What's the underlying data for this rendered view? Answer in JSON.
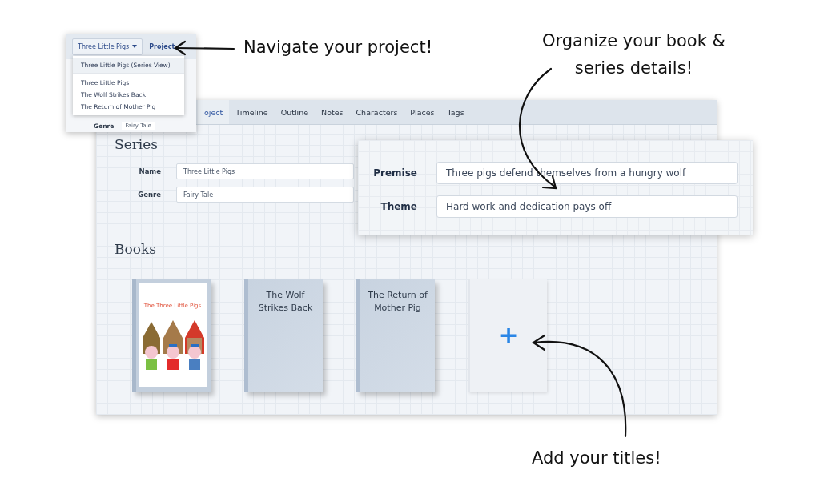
{
  "window": {
    "tabs": [
      {
        "label": "oject",
        "selected": true
      },
      {
        "label": "Timeline",
        "selected": false
      },
      {
        "label": "Outline",
        "selected": false
      },
      {
        "label": "Notes",
        "selected": false
      },
      {
        "label": "Characters",
        "selected": false
      },
      {
        "label": "Places",
        "selected": false
      },
      {
        "label": "Tags",
        "selected": false
      }
    ],
    "series": {
      "heading": "Series",
      "fields": [
        {
          "label": "Name",
          "value": "Three Little Pigs"
        },
        {
          "label": "Genre",
          "value": "Fairy Tale"
        }
      ]
    },
    "books": {
      "heading": "Books",
      "items": [
        {
          "kind": "cover",
          "title": "The Three Little Pigs"
        },
        {
          "kind": "plain",
          "title": "The Wolf Strikes Back"
        },
        {
          "kind": "plain",
          "title": "The Return of Mother Pig"
        },
        {
          "kind": "add",
          "title": "+"
        }
      ]
    }
  },
  "details_card": {
    "fields": [
      {
        "label": "Premise",
        "value": "Three pigs defend themselves from a hungry wolf"
      },
      {
        "label": "Theme",
        "value": "Hard work and dedication pays off"
      }
    ]
  },
  "navigator": {
    "project_button": "Three Little Pigs",
    "link": "Project",
    "menu": [
      {
        "kind": "series",
        "label": "Three Little Pigs (Series View)",
        "selected": true
      },
      {
        "kind": "book",
        "label": "Three Little Pigs",
        "selected": false
      },
      {
        "kind": "book",
        "label": "The Wolf Strikes Back",
        "selected": false
      },
      {
        "kind": "book",
        "label": "The Return of Mother Pig",
        "selected": false
      }
    ],
    "peek_field": {
      "label": "Genre",
      "value": "Fairy Tale"
    }
  },
  "annotations": [
    {
      "lines": [
        "Navigate your project!"
      ]
    },
    {
      "lines": [
        "Organize your book &",
        "series details!"
      ]
    },
    {
      "lines": [
        "Add your titles!"
      ]
    }
  ]
}
